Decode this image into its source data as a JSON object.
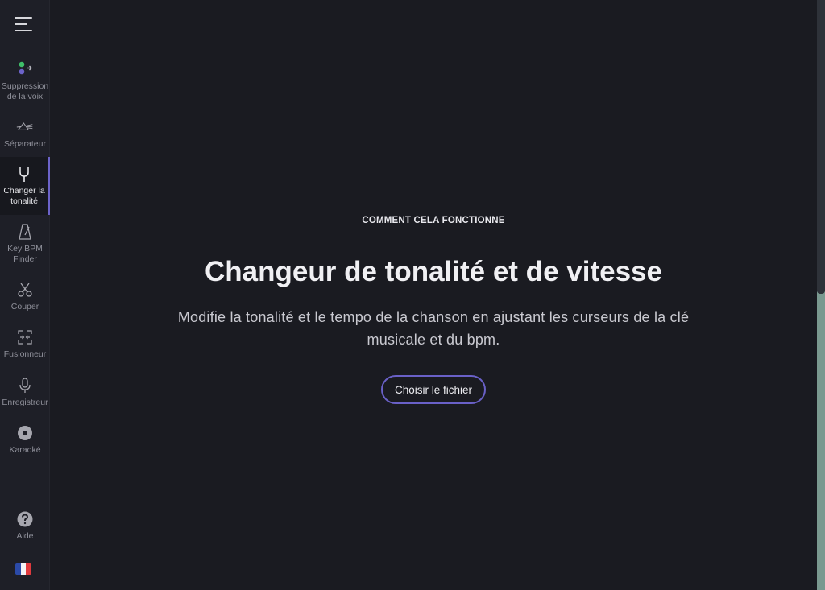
{
  "sidebar": {
    "items": [
      {
        "label": "Suppression de la voix",
        "icon": "voice-remover-icon"
      },
      {
        "label": "Séparateur",
        "icon": "prism-splitter-icon"
      },
      {
        "label": "Changer la tonalité",
        "icon": "tuning-fork-icon"
      },
      {
        "label": "Key BPM Finder",
        "icon": "metronome-icon"
      },
      {
        "label": "Couper",
        "icon": "scissors-icon"
      },
      {
        "label": "Fusionneur",
        "icon": "joiner-icon"
      },
      {
        "label": "Enregistreur",
        "icon": "microphone-icon"
      },
      {
        "label": "Karaoké",
        "icon": "disc-icon"
      }
    ],
    "help_label": "Aide",
    "active_item": "Changer la tonalité",
    "language_flag": "french-flag-icon"
  },
  "main": {
    "eyebrow": "COMMENT CELA FONCTIONNE",
    "title": "Changeur de tonalité et de vitesse",
    "subtitle": "Modifie la tonalité et le tempo de la chanson en ajustant les curseurs de la clé musicale et du bpm.",
    "choose_button": "Choisir le fichier"
  },
  "colors": {
    "background": "#1a1b21",
    "sidebar": "#1e1f27",
    "accent": "#6a61c8",
    "text": "#f0f0f3",
    "muted_text": "#8e8f99"
  }
}
